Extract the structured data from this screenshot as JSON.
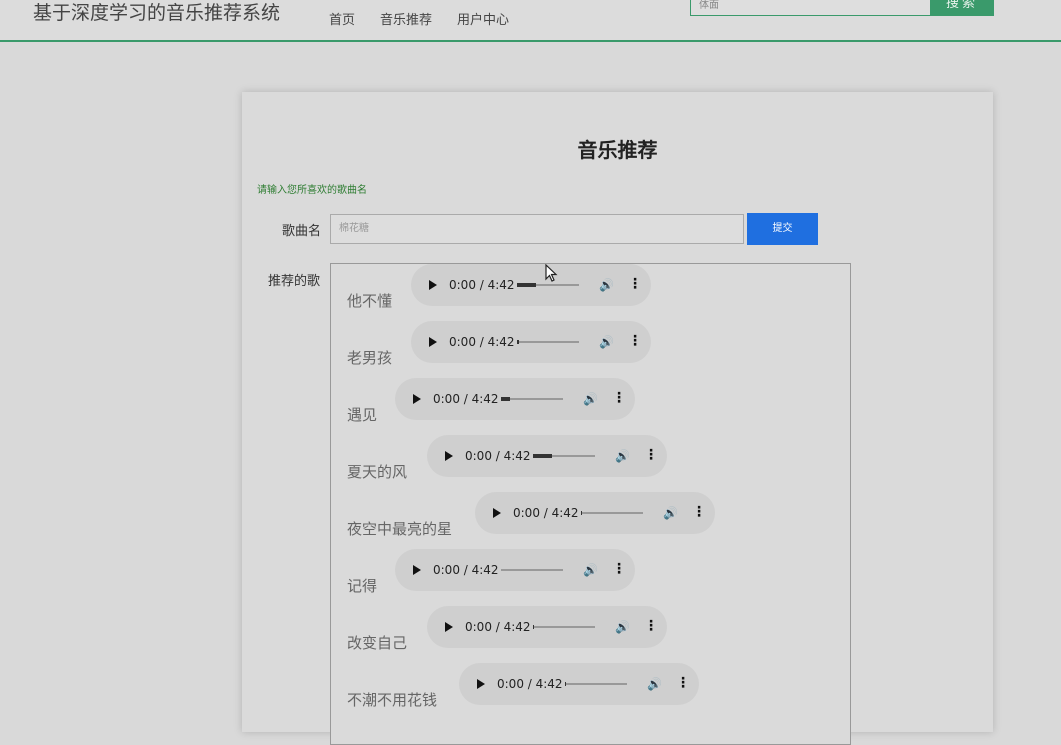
{
  "header": {
    "brand": "基于深度学习的音乐推荐系统",
    "nav": [
      "首页",
      "音乐推荐",
      "用户中心"
    ],
    "search_placeholder": "体面",
    "search_button": "搜索"
  },
  "page": {
    "title": "音乐推荐",
    "hint": "请输入您所喜欢的歌曲名",
    "field_label": "歌曲名",
    "song_input_placeholder": "棉花糖",
    "submit_label": "提交",
    "recommend_label": "推荐的歌"
  },
  "songs": [
    {
      "name": "他不懂",
      "time": "0:00 / 4:42",
      "progress": 0.3
    },
    {
      "name": "老男孩",
      "time": "0:00 / 4:42",
      "progress": 0.03
    },
    {
      "name": "遇见",
      "time": "0:00 / 4:42",
      "progress": 0.15
    },
    {
      "name": "夏天的风",
      "time": "0:00 / 4:42",
      "progress": 0.3
    },
    {
      "name": "夜空中最亮的星",
      "time": "0:00 / 4:42",
      "progress": 0.02
    },
    {
      "name": "记得",
      "time": "0:00 / 4:42",
      "progress": 0.0
    },
    {
      "name": "改变自己",
      "time": "0:00 / 4:42",
      "progress": 0.02
    },
    {
      "name": "不潮不用花钱",
      "time": "0:00 / 4:42",
      "progress": 0.02
    }
  ],
  "colors": {
    "accent": "#3a9a6b",
    "submit": "#1f6fe0",
    "hint": "#2e7d32"
  },
  "icons": {
    "play": "play-icon",
    "volume": "volume-icon",
    "more": "more-vertical-icon"
  }
}
